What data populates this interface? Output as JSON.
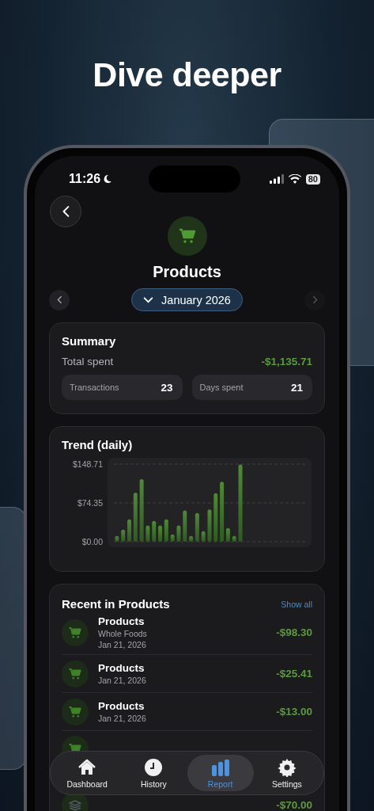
{
  "headline": "Dive deeper",
  "status_bar": {
    "time": "11:26",
    "battery": "80"
  },
  "header": {
    "title": "Products",
    "month": "January 2026"
  },
  "summary": {
    "title": "Summary",
    "total_label": "Total spent",
    "total_value": "-$1,135.71",
    "stats": [
      {
        "label": "Transactions",
        "value": "23"
      },
      {
        "label": "Days spent",
        "value": "21"
      }
    ]
  },
  "trend": {
    "title": "Trend (daily)",
    "chart_data": {
      "type": "bar",
      "ylim": [
        0,
        148.71
      ],
      "yticks": [
        {
          "value": 148.71,
          "label": "$148.71"
        },
        {
          "value": 74.35,
          "label": "$74.35"
        },
        {
          "value": 0,
          "label": "$0.00"
        }
      ],
      "values": [
        11,
        23,
        43,
        94,
        120,
        31,
        40,
        31,
        43,
        14,
        31,
        60,
        11,
        55,
        20,
        62,
        93,
        115,
        26,
        11,
        148,
        null,
        null,
        null,
        null,
        null,
        null,
        null,
        null,
        null,
        null
      ]
    }
  },
  "recent": {
    "title": "Recent in Products",
    "action": "Show all",
    "items": [
      {
        "kind": "cart",
        "title": "Products",
        "merchant": "Whole Foods",
        "date": "Jan 21, 2026",
        "amount": "-$98.30"
      },
      {
        "kind": "cart",
        "title": "Products",
        "date": "Jan 21, 2026",
        "amount": "-$25.41"
      },
      {
        "kind": "cart",
        "title": "Products",
        "date": "Jan 21, 2026",
        "amount": "-$13.00"
      },
      {
        "kind": "cart"
      },
      {
        "kind": "books",
        "amount": "-$70.00"
      }
    ]
  },
  "tab_bar": [
    {
      "label": "Dashboard",
      "selected": false
    },
    {
      "label": "History",
      "selected": false
    },
    {
      "label": "Report",
      "selected": true
    },
    {
      "label": "Settings",
      "selected": false
    }
  ]
}
